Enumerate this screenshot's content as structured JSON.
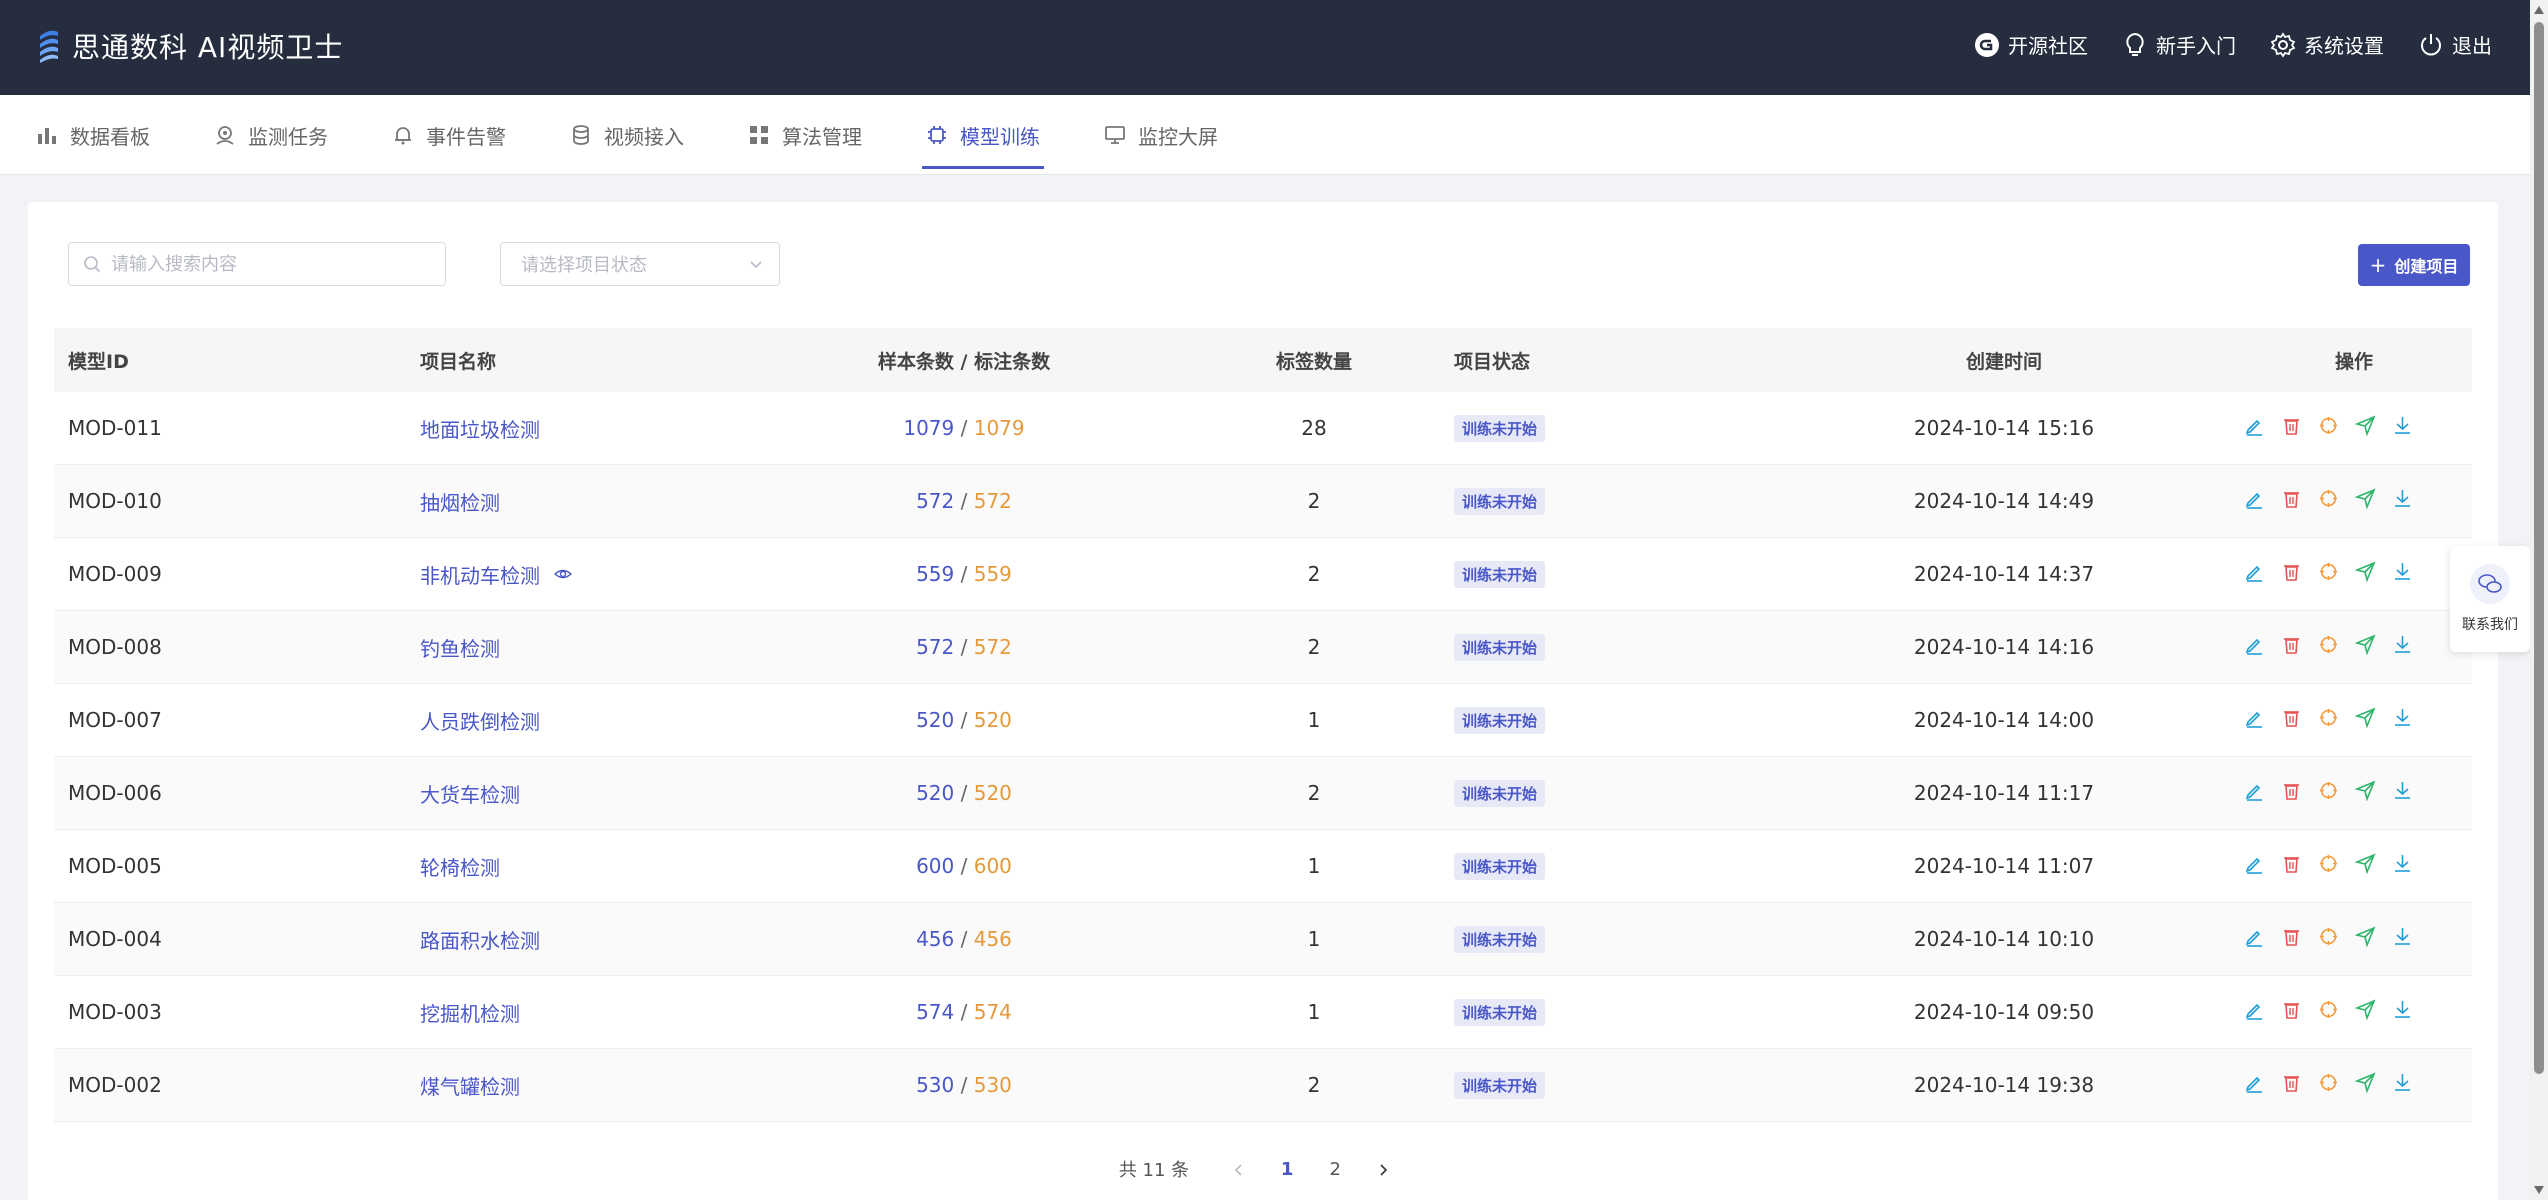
{
  "app": {
    "title": "思通数科 AI视频卫士"
  },
  "top_actions": [
    {
      "label": "开源社区",
      "icon": "open-source-icon"
    },
    {
      "label": "新手入门",
      "icon": "bulb-icon"
    },
    {
      "label": "系统设置",
      "icon": "gear-icon"
    },
    {
      "label": "退出",
      "icon": "power-icon"
    }
  ],
  "nav": {
    "tabs": [
      {
        "label": "数据看板",
        "icon": "bar-chart-icon"
      },
      {
        "label": "监测任务",
        "icon": "location-icon"
      },
      {
        "label": "事件告警",
        "icon": "bell-icon"
      },
      {
        "label": "视频接入",
        "icon": "database-icon"
      },
      {
        "label": "算法管理",
        "icon": "grid-icon"
      },
      {
        "label": "模型训练",
        "icon": "chip-icon"
      },
      {
        "label": "监控大屏",
        "icon": "monitor-icon"
      }
    ],
    "active_index": 5
  },
  "filters": {
    "search_placeholder": "请输入搜索内容",
    "status_placeholder": "请选择项目状态",
    "create_label": "创建项目"
  },
  "table": {
    "headers": [
      "模型ID",
      "项目名称",
      "样本条数 / 标注条数",
      "标签数量",
      "项目状态",
      "创建时间",
      "操作"
    ],
    "rows": [
      {
        "id": "MOD-011",
        "name": "地面垃圾检测",
        "samples": "1079",
        "labeled": "1079",
        "tags": "28",
        "status": "训练未开始",
        "created": "2024-10-14 15:16",
        "eye": false
      },
      {
        "id": "MOD-010",
        "name": "抽烟检测",
        "samples": "572",
        "labeled": "572",
        "tags": "2",
        "status": "训练未开始",
        "created": "2024-10-14 14:49",
        "eye": false
      },
      {
        "id": "MOD-009",
        "name": "非机动车检测",
        "samples": "559",
        "labeled": "559",
        "tags": "2",
        "status": "训练未开始",
        "created": "2024-10-14 14:37",
        "eye": true
      },
      {
        "id": "MOD-008",
        "name": "钓鱼检测",
        "samples": "572",
        "labeled": "572",
        "tags": "2",
        "status": "训练未开始",
        "created": "2024-10-14 14:16",
        "eye": false
      },
      {
        "id": "MOD-007",
        "name": "人员跌倒检测",
        "samples": "520",
        "labeled": "520",
        "tags": "1",
        "status": "训练未开始",
        "created": "2024-10-14 14:00",
        "eye": false
      },
      {
        "id": "MOD-006",
        "name": "大货车检测",
        "samples": "520",
        "labeled": "520",
        "tags": "2",
        "status": "训练未开始",
        "created": "2024-10-14 11:17",
        "eye": false
      },
      {
        "id": "MOD-005",
        "name": "轮椅检测",
        "samples": "600",
        "labeled": "600",
        "tags": "1",
        "status": "训练未开始",
        "created": "2024-10-14 11:07",
        "eye": false
      },
      {
        "id": "MOD-004",
        "name": "路面积水检测",
        "samples": "456",
        "labeled": "456",
        "tags": "1",
        "status": "训练未开始",
        "created": "2024-10-14 10:10",
        "eye": false
      },
      {
        "id": "MOD-003",
        "name": "挖掘机检测",
        "samples": "574",
        "labeled": "574",
        "tags": "1",
        "status": "训练未开始",
        "created": "2024-10-14 09:50",
        "eye": false
      },
      {
        "id": "MOD-002",
        "name": "煤气罐检测",
        "samples": "530",
        "labeled": "530",
        "tags": "2",
        "status": "训练未开始",
        "created": "2024-10-14 19:38",
        "eye": false
      }
    ],
    "actions": [
      "edit-icon",
      "delete-icon",
      "target-icon",
      "send-icon",
      "download-icon"
    ]
  },
  "pagination": {
    "total": "共 11 条",
    "pages": [
      "1",
      "2"
    ],
    "current": "1"
  },
  "contact": {
    "label": "联系我们"
  },
  "colors": {
    "accent": "#4a57c8",
    "header_bg": "#252d3f",
    "orange": "#e49a3a",
    "edit": "#1f9fd8",
    "delete": "#e45454",
    "target": "#f39c3a",
    "send": "#2fb56a",
    "download": "#1f9fd8"
  }
}
